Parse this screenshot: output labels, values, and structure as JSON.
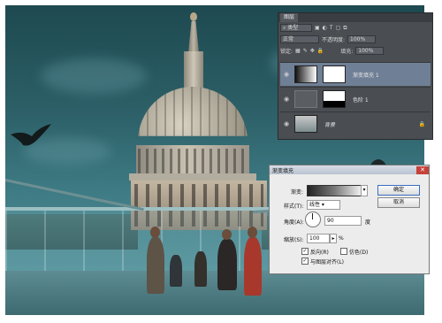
{
  "layers_panel": {
    "tab_label": "图层",
    "filter_label": "类型",
    "blend_mode": "正常",
    "opacity_label": "不透明度:",
    "opacity_value": "100%",
    "lock_label": "锁定:",
    "fill_label": "填充:",
    "fill_value": "100%",
    "layers": [
      {
        "name": "渐变填充 1",
        "selected": true
      },
      {
        "name": "色阶 1",
        "selected": false
      },
      {
        "name": "背景",
        "selected": false,
        "locked": true
      }
    ]
  },
  "gradient_dialog": {
    "title": "渐变填充",
    "close_glyph": "✕",
    "gradient_label": "渐变:",
    "style_label": "样式(T):",
    "style_value": "线性",
    "angle_label": "角度(A):",
    "angle_value": "90",
    "angle_unit": "度",
    "scale_label": "缩放(S):",
    "scale_value": "100",
    "scale_unit": "%",
    "reverse_label": "反向(R)",
    "reverse_checked": true,
    "dither_label": "仿色(D)",
    "dither_checked": false,
    "align_label": "与图层对齐(L)",
    "align_checked": true,
    "ok_label": "确定",
    "cancel_label": "取消"
  },
  "colors": {
    "panel_bg": "#4a4d51",
    "selected_layer": "#6f7f96",
    "dialog_bg": "#ececec"
  }
}
